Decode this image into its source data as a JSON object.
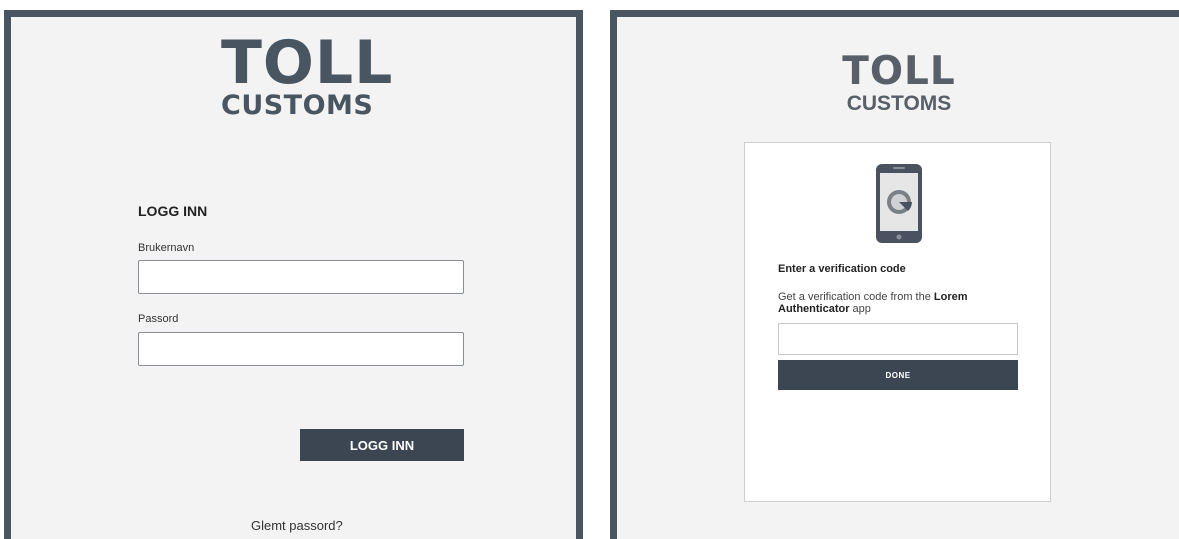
{
  "brand": {
    "name": "TOLL",
    "sub": "CUSTOMS"
  },
  "login": {
    "heading": "LOGG INN",
    "username_label": "Brukernavn",
    "username_value": "",
    "password_label": "Passord",
    "password_value": "",
    "submit_label": "LOGG INN",
    "forgot_label": "Glemt passord?"
  },
  "verify": {
    "icon": "phone-icon",
    "title": "Enter a verification code",
    "desc_prefix": "Get a verification code from the ",
    "desc_app_name": "Lorem Authenticator",
    "desc_suffix": " app",
    "code_value": "",
    "submit_label": "DONE"
  },
  "colors": {
    "frame": "#4a5562",
    "button": "#3c4653",
    "panel_bg": "#f3f3f3"
  }
}
